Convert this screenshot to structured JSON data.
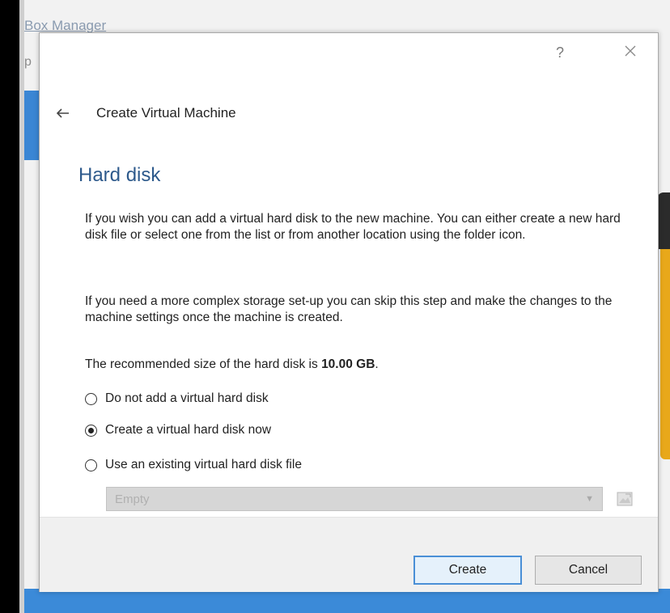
{
  "background": {
    "app_title": "Box Manager",
    "side_letter": "p"
  },
  "dialog": {
    "help_label": "?",
    "close_icon": "close-icon",
    "back_icon": "back-arrow-icon",
    "header_title": "Create Virtual Machine",
    "section_title": "Hard disk",
    "paragraph1": "If you wish you can add a virtual hard disk to the new machine. You can either create a new hard disk file or select one from the list or from another location using the folder icon.",
    "paragraph2": "If you need a more complex storage set-up you can skip this step and make the changes to the machine settings once the machine is created.",
    "recommended_prefix": "The recommended size of the hard disk is ",
    "recommended_size": "10.00 GB",
    "recommended_suffix": ".",
    "options": [
      {
        "label": "Do not add a virtual hard disk",
        "checked": false
      },
      {
        "label": "Create a virtual hard disk now",
        "checked": true
      },
      {
        "label": "Use an existing virtual hard disk file",
        "checked": false
      }
    ],
    "existing_disk_select": {
      "value": "Empty",
      "disabled": true
    },
    "folder_icon": "folder-icon",
    "buttons": {
      "create": "Create",
      "cancel": "Cancel"
    }
  },
  "colors": {
    "section_title": "#2e5a8c",
    "accent_blue": "#3b8ad8",
    "default_button_border": "#4a8fd6"
  }
}
